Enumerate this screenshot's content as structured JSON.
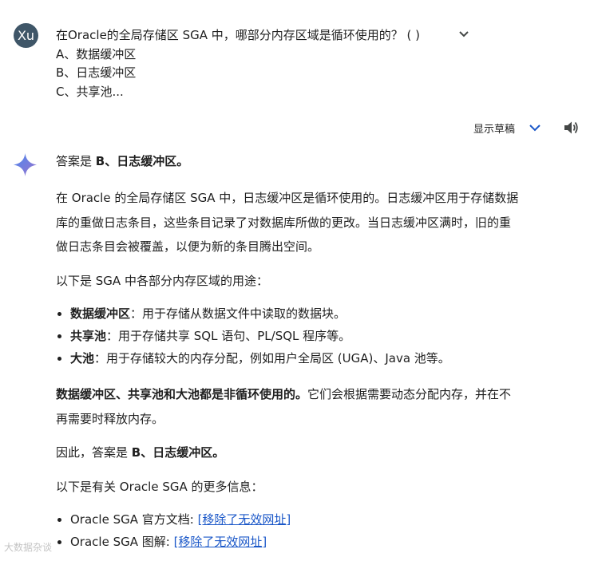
{
  "user": {
    "avatar_text": "Xu",
    "prompt_lines": [
      "在Oracle的全局存储区 SGA 中，哪部分内存区域是循环使用的？ ( )",
      "A、数据缓冲区",
      "B、日志缓冲区",
      "C、共享池..."
    ]
  },
  "drafts": {
    "label": "显示草稿"
  },
  "icons": {
    "expand": "chevron-down-icon",
    "drafts": "chevron-down-icon",
    "speaker": "speaker-icon",
    "model": "sparkle-icon"
  },
  "colors": {
    "avatar_bg": "#3f5668",
    "link": "#1a57c8",
    "accent_blue": "#1a57c8",
    "spark_blue": "#4a88f0",
    "spark_purple": "#9b72cb"
  },
  "response": {
    "answer_prefix": "答案是 ",
    "answer_bold": "B、日志缓冲区。",
    "para1_lines": [
      "在 Oracle 的全局存储区 SGA 中，日志缓冲区是循环使用的。日志缓冲区用于存储数据",
      "库的重做日志条目，这些条目记录了对数据库所做的更改。当日志缓冲区满时，旧的重",
      "做日志条目会被覆盖，以便为新的条目腾出空间。"
    ],
    "para2": "以下是 SGA 中各部分内存区域的用途：",
    "bullets": [
      {
        "term": "数据缓冲区",
        "desc": "：用于存储从数据文件中读取的数据块。"
      },
      {
        "term": "共享池",
        "desc": "：用于存储共享 SQL 语句、PL/SQL 程序等。"
      },
      {
        "term": "大池",
        "desc": "：用于存储较大的内存分配，例如用户全局区 (UGA)、Java 池等。"
      }
    ],
    "para3_bold": "数据缓冲区、共享池和大池都是非循环使用的。",
    "para3_rest_line1": "它们会根据需要动态分配内存，并在不",
    "para3_line2": "再需要时释放内存。",
    "conclusion_prefix": "因此，答案是 ",
    "conclusion_bold": "B、日志缓冲区。",
    "more_info": "以下是有关 Oracle SGA 的更多信息：",
    "links": [
      {
        "label": "Oracle SGA 官方文档: ",
        "link": "[移除了无效网址]"
      },
      {
        "label": "Oracle SGA 图解: ",
        "link": "[移除了无效网址]"
      }
    ]
  },
  "watermark": "大数据杂谈"
}
